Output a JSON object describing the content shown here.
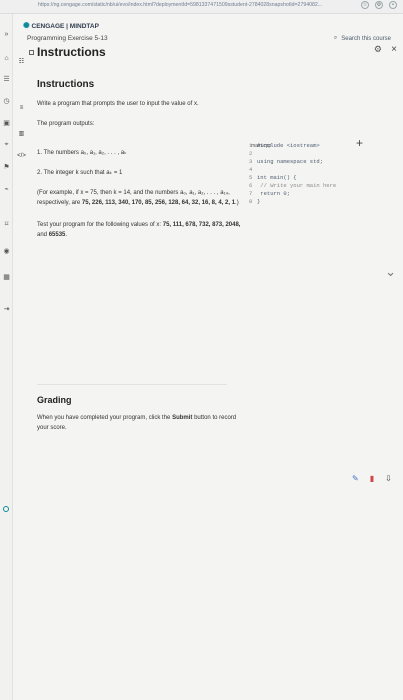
{
  "browser": {
    "url": "https://ng.cengage.com/static/nb/ui/evo/index.html?deploymentId=5981337471509sstudent-2784028snapshotId=2794082...",
    "tab_icons": [
      "back-icon",
      "reload-icon",
      "star-icon",
      "settings-icon",
      "account-icon"
    ]
  },
  "header": {
    "brand": "CENGAGE | MINDTAP",
    "program": "Programming Exercise 5-13",
    "search": "Search this course"
  },
  "instructions": {
    "title": "Instructions",
    "section": "Instructions",
    "intro": "Write a program that prompts the user to input the value of x.",
    "outputs": "The program outputs:",
    "item1": "1. The numbers a₀, a₁, a₂, . . . , aₖ",
    "item2": "2. The integer k such that aₖ = 1",
    "example_line1": "(For example, if x = 75, then k = 14, and the numbers a₀, a₁, a₂, . . . , a₁₄,",
    "example_line2_prefix": "respectively, are ",
    "example_line2_bold": "75, 226, 113, 340, 170, 85, 256, 128, 64, 32, 16, 8, 4, 2, 1",
    "example_line2_suffix": ".)",
    "test_line1_prefix": "Test your program for the following values of x: ",
    "test_line1_bold": "75, 111, 678, 732, 873, 2048,",
    "test_line2_prefix": "and ",
    "test_line2_bold": "65535",
    "test_line2_suffix": ".",
    "grading": "Grading",
    "grading_line1_prefix": "When you have completed your program, click the ",
    "grading_line1_bold": "Submit",
    "grading_line1_suffix": " button to record",
    "grading_line2": "your score."
  },
  "editor": {
    "filename": "main.cpp",
    "lines": [
      {
        "n": "1",
        "text": "#include <iostream>"
      },
      {
        "n": "2",
        "text": ""
      },
      {
        "n": "3",
        "text": "using namespace std;"
      },
      {
        "n": "4",
        "text": ""
      },
      {
        "n": "5",
        "text": "int main() {"
      },
      {
        "n": "6",
        "text": "    // Write your main here"
      },
      {
        "n": "7",
        "text": "    return 0;"
      },
      {
        "n": "8",
        "text": "}"
      }
    ]
  }
}
